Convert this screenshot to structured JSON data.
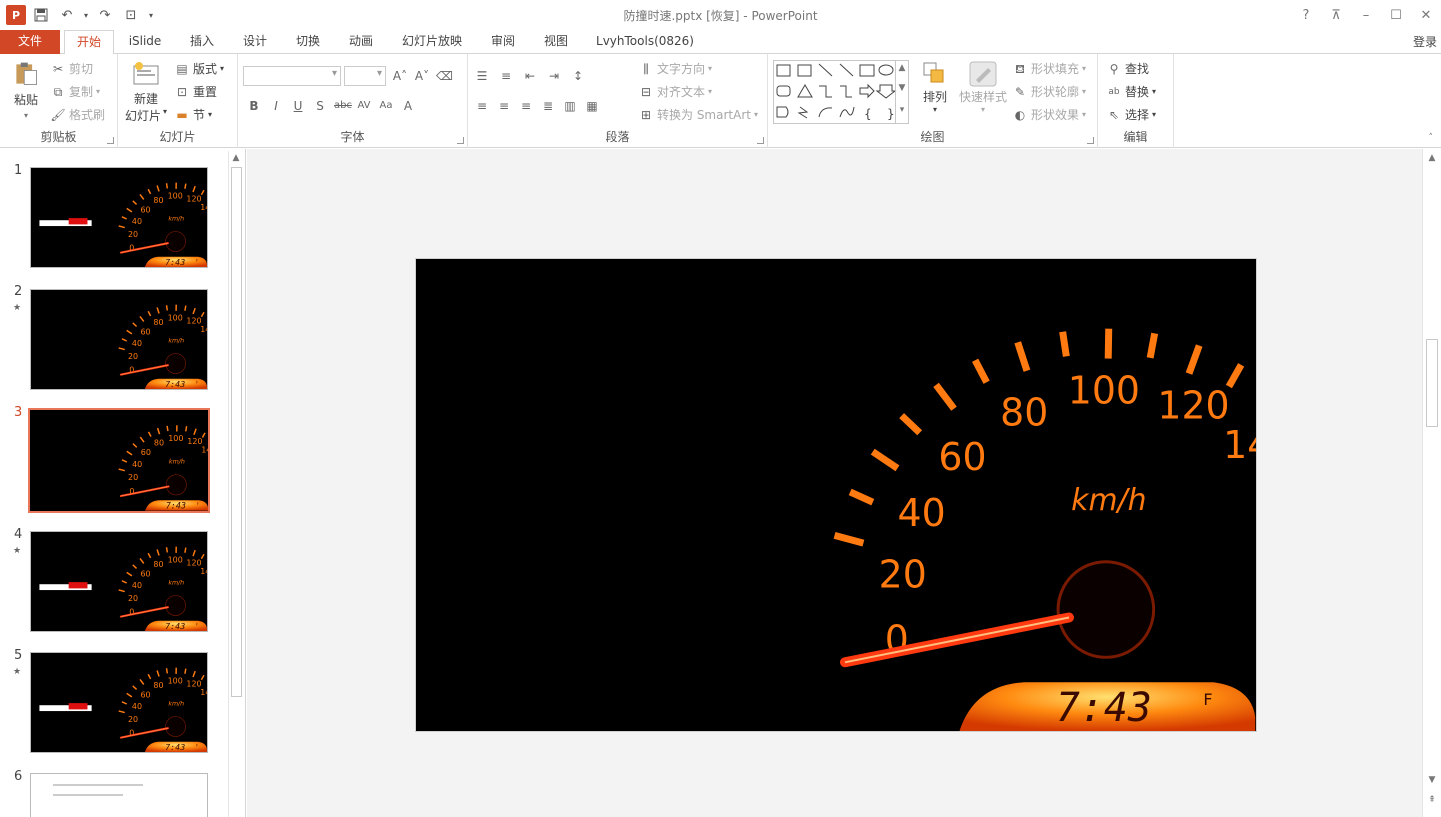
{
  "window": {
    "title": "防撞时速.pptx [恢复] - PowerPoint",
    "login_label": "登录",
    "app_icon_label": "P"
  },
  "tabs": [
    {
      "label": "文件"
    },
    {
      "label": "开始"
    },
    {
      "label": "iSlide"
    },
    {
      "label": "插入"
    },
    {
      "label": "设计"
    },
    {
      "label": "切换"
    },
    {
      "label": "动画"
    },
    {
      "label": "幻灯片放映"
    },
    {
      "label": "审阅"
    },
    {
      "label": "视图"
    },
    {
      "label": "LvyhTools(0826)"
    }
  ],
  "ribbon": {
    "clipboard": {
      "label": "剪贴板",
      "paste": "粘贴",
      "cut": "剪切",
      "copy": "复制",
      "format_painter": "格式刷"
    },
    "slides": {
      "label": "幻灯片",
      "new_slide_1": "新建",
      "new_slide_2": "幻灯片",
      "layout": "版式",
      "reset": "重置",
      "section": "节"
    },
    "font": {
      "label": "字体"
    },
    "paragraph": {
      "label": "段落",
      "text_direction": "文字方向",
      "align_text": "对齐文本",
      "convert_smartart": "转换为 SmartArt"
    },
    "drawing": {
      "label": "绘图",
      "arrange": "排列",
      "quick_styles": "快速样式",
      "shape_fill": "形状填充",
      "shape_outline": "形状轮廓",
      "shape_effects": "形状效果"
    },
    "editing": {
      "label": "编辑",
      "find": "查找",
      "replace": "替换",
      "select": "选择"
    }
  },
  "thumbnails": [
    {
      "num": "1",
      "star": "",
      "selected": false,
      "banner": true
    },
    {
      "num": "2",
      "star": "★",
      "selected": false,
      "banner": false
    },
    {
      "num": "3",
      "star": "",
      "selected": true,
      "banner": false
    },
    {
      "num": "4",
      "star": "★",
      "selected": false,
      "banner": true
    },
    {
      "num": "5",
      "star": "★",
      "selected": false,
      "banner": true
    },
    {
      "num": "6",
      "star": "",
      "selected": false,
      "banner": false
    }
  ],
  "speedometer": {
    "labels": [
      "0",
      "20",
      "40",
      "60",
      "80",
      "100",
      "120",
      "14"
    ],
    "unit": "km/h",
    "clock": "7:43",
    "fuel_mark": "F"
  },
  "colors": {
    "accent": "#d24726",
    "gauge": "#ff7a10",
    "needle": "#ff3a10"
  }
}
